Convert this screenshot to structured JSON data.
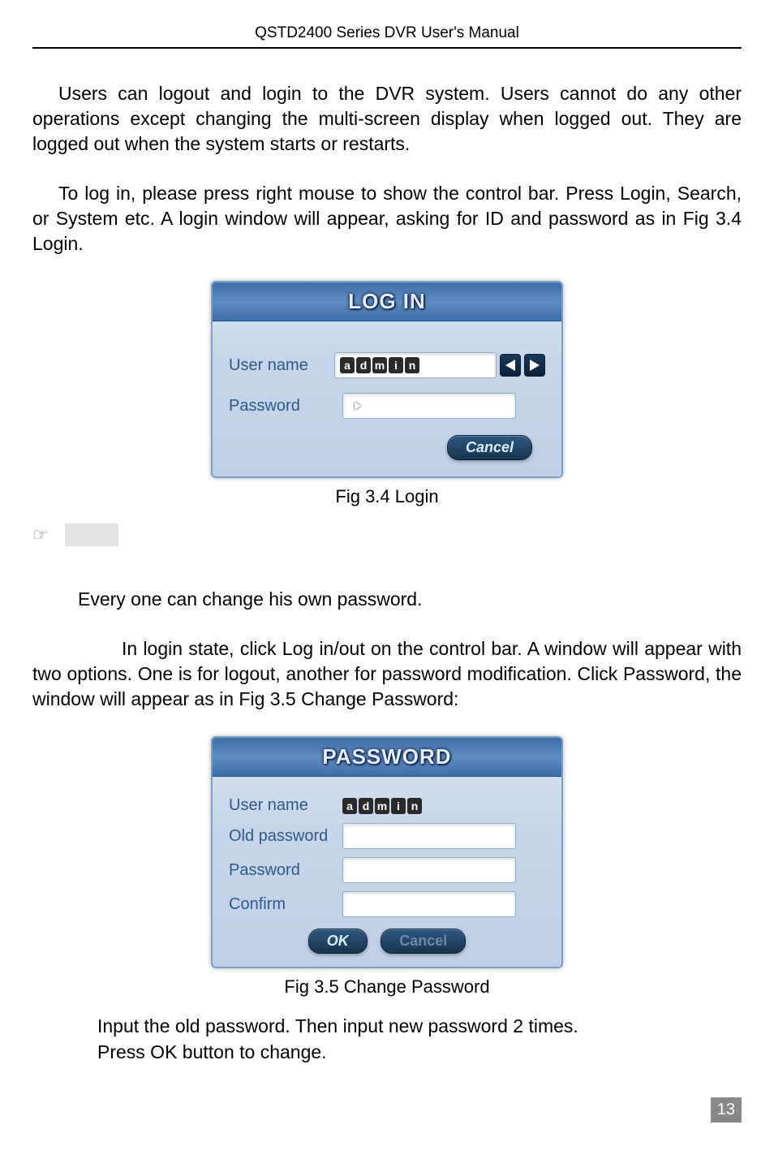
{
  "header": "QSTD2400 Series DVR User's Manual",
  "para1": "Users can logout and login to the DVR system. Users cannot do any other operations except changing the multi-screen display when logged out. They are logged out when the system starts or restarts.",
  "para2": "To log in, please press right mouse to show the control bar. Press Login, Search, or System etc. A login window will appear, asking for ID and password as in Fig 3.4 Login.",
  "login": {
    "title": "LOG IN",
    "user_label": "User name",
    "user_value_chars": [
      "a",
      "d",
      "m",
      "i",
      "n"
    ],
    "password_label": "Password",
    "cancel": "Cancel"
  },
  "caption1": "Fig 3.4 Login",
  "para3": "Every one can change his own password.",
  "para4": "In login state, click Log in/out on the control bar. A window will appear with two options. One is for logout, another for password modification. Click Password, the window will appear as in Fig 3.5    Change Password:",
  "password": {
    "title": "PASSWORD",
    "user_label": "User name",
    "user_value_chars": [
      "a",
      "d",
      "m",
      "i",
      "n"
    ],
    "old_label": "Old password",
    "pw_label": "Password",
    "confirm_label": "Confirm",
    "ok": "OK",
    "cancel": "Cancel"
  },
  "caption2": "Fig 3.5    Change Password",
  "para5": "Input the old password. Then input new password 2 times.",
  "para6": "Press OK button to change.",
  "page_number": "13"
}
